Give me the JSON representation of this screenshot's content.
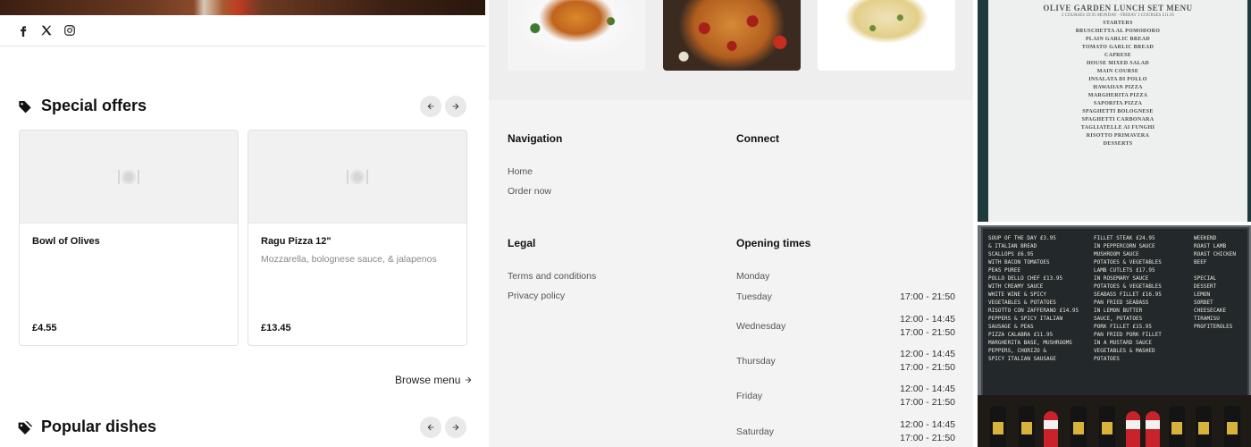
{
  "social": [
    "facebook-icon",
    "x-icon",
    "instagram-icon"
  ],
  "special_offers": {
    "title": "Special offers",
    "cards": [
      {
        "name": "Bowl of Olives",
        "desc": "",
        "price": "£4.55"
      },
      {
        "name": "Ragu Pizza 12\"",
        "desc": "Mozzarella, bolognese sauce, & jalapenos",
        "price": "£13.45"
      }
    ],
    "browse": "Browse menu"
  },
  "popular": {
    "title": "Popular dishes"
  },
  "footer": {
    "navigation": {
      "title": "Navigation",
      "links": [
        "Home",
        "Order now"
      ]
    },
    "connect": {
      "title": "Connect"
    },
    "legal": {
      "title": "Legal",
      "links": [
        "Terms and conditions",
        "Privacy policy"
      ]
    },
    "opening": {
      "title": "Opening times",
      "days": [
        {
          "day": "Monday",
          "times": []
        },
        {
          "day": "Tuesday",
          "times": [
            "17:00 - 21:50"
          ]
        },
        {
          "day": "Wednesday",
          "times": [
            "12:00 - 14:45",
            "17:00 - 21:50"
          ]
        },
        {
          "day": "Thursday",
          "times": [
            "12:00 - 14:45",
            "17:00 - 21:50"
          ]
        },
        {
          "day": "Friday",
          "times": [
            "12:00 - 14:45",
            "17:00 - 21:50"
          ]
        },
        {
          "day": "Saturday",
          "times": [
            "12:00 - 14:45",
            "17:00 - 21:50"
          ]
        }
      ]
    }
  },
  "lunch_menu_photo": {
    "title": "OLIVE GARDEN LUNCH SET MENU",
    "subtitle": "2 COURSES £9.95   MONDAY - FRIDAY   3 COURSES £11.95",
    "items": [
      "STARTERS",
      "BRUSCHETTA AL POMODORO",
      "PLAIN GARLIC BREAD",
      "TOMATO GARLIC BREAD",
      "CAPRESE",
      "HOUSE MIXED SALAD",
      "MAIN COURSE",
      "INSALATA DI POLLO",
      "HAWAIIAN PIZZA",
      "MARGHERITA PIZZA",
      "SAPORITA PIZZA",
      "SPAGHETTI BOLOGNESE",
      "SPAGHETTI CARBONARA",
      "TAGLIATELLE AI FUNGHI",
      "RISOTTO PRIMAVERA",
      "DESSERTS"
    ]
  },
  "chalkboard_photo": {
    "col1": "SOUP OF THE DAY £3.95\n& ITALIAN BREAD\nSCALLOPS £6.95\nWITH BACON TOMATOES\nPEAS PUREE\nPOLLO DELLO CHEF £13.95\nWITH CREAMY SAUCE\nWHITE WINE & SPICY\nVEGETABLES & POTATOES\nRISOTTO CON ZAFFERANO £14.95\nPEPPERS & SPICY ITALIAN\nSAUSAGE & PEAS\nPIZZA CALABRA £11.95\nMARGHERITA BASE, MUSHROOMS\nPEPPERS, CHORIZO &\nSPICY ITALIAN SAUSAGE",
    "col2": "FILLET STEAK £24.95\nIN PEPPERCORN SAUCE\nMUSHROOM SAUCE\nPOTATOES & VEGETABLES\nLAMB CUTLETS £17.95\nIN ROSEMARY SAUCE\nPOTATOES & VEGETABLES\nSEABASS FILLET £16.95\nPAN FRIED SEABASS\nIN LEMON BUTTER\nSAUCE, POTATOES\nPORK FILLET £15.95\nPAN FRIED PORK FILLET\nIN A MUSTARD SAUCE\nVEGETABLES & MASHED\nPOTATOES",
    "col3": "WEEKEND\nROAST LAMB\nROAST CHICKEN\nBEEF\n\nSPECIAL\nDESSERT\nLEMON\nSORBET\nCHEESECAKE\nTIRAMISU\nPROFITEROLES"
  }
}
